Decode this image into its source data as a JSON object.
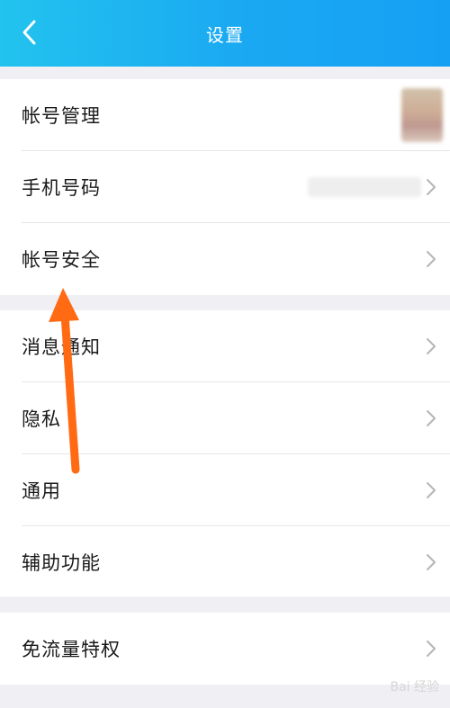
{
  "header": {
    "title": "设置",
    "back_icon": "chevron-left-icon",
    "gradient_start": "#22c3ee",
    "gradient_end": "#16a0f4"
  },
  "groups": [
    {
      "items": [
        {
          "label": "帐号管理",
          "accessory": "avatar"
        },
        {
          "label": "手机号码",
          "accessory": "blurred-phone-number"
        },
        {
          "label": "帐号安全",
          "accessory": "chevron-right-icon"
        }
      ]
    },
    {
      "items": [
        {
          "label": "消息通知",
          "accessory": "chevron-right-icon"
        },
        {
          "label": "隐私",
          "accessory": "chevron-right-icon"
        },
        {
          "label": "通用",
          "accessory": "chevron-right-icon"
        },
        {
          "label": "辅助功能",
          "accessory": "chevron-right-icon"
        }
      ]
    },
    {
      "items": [
        {
          "label": "免流量特权",
          "accessory": "chevron-right-icon"
        }
      ]
    }
  ],
  "annotation": {
    "icon": "orange-arrow-icon",
    "color": "#ff6a13"
  },
  "watermark": {
    "text": "Bai 经验"
  }
}
